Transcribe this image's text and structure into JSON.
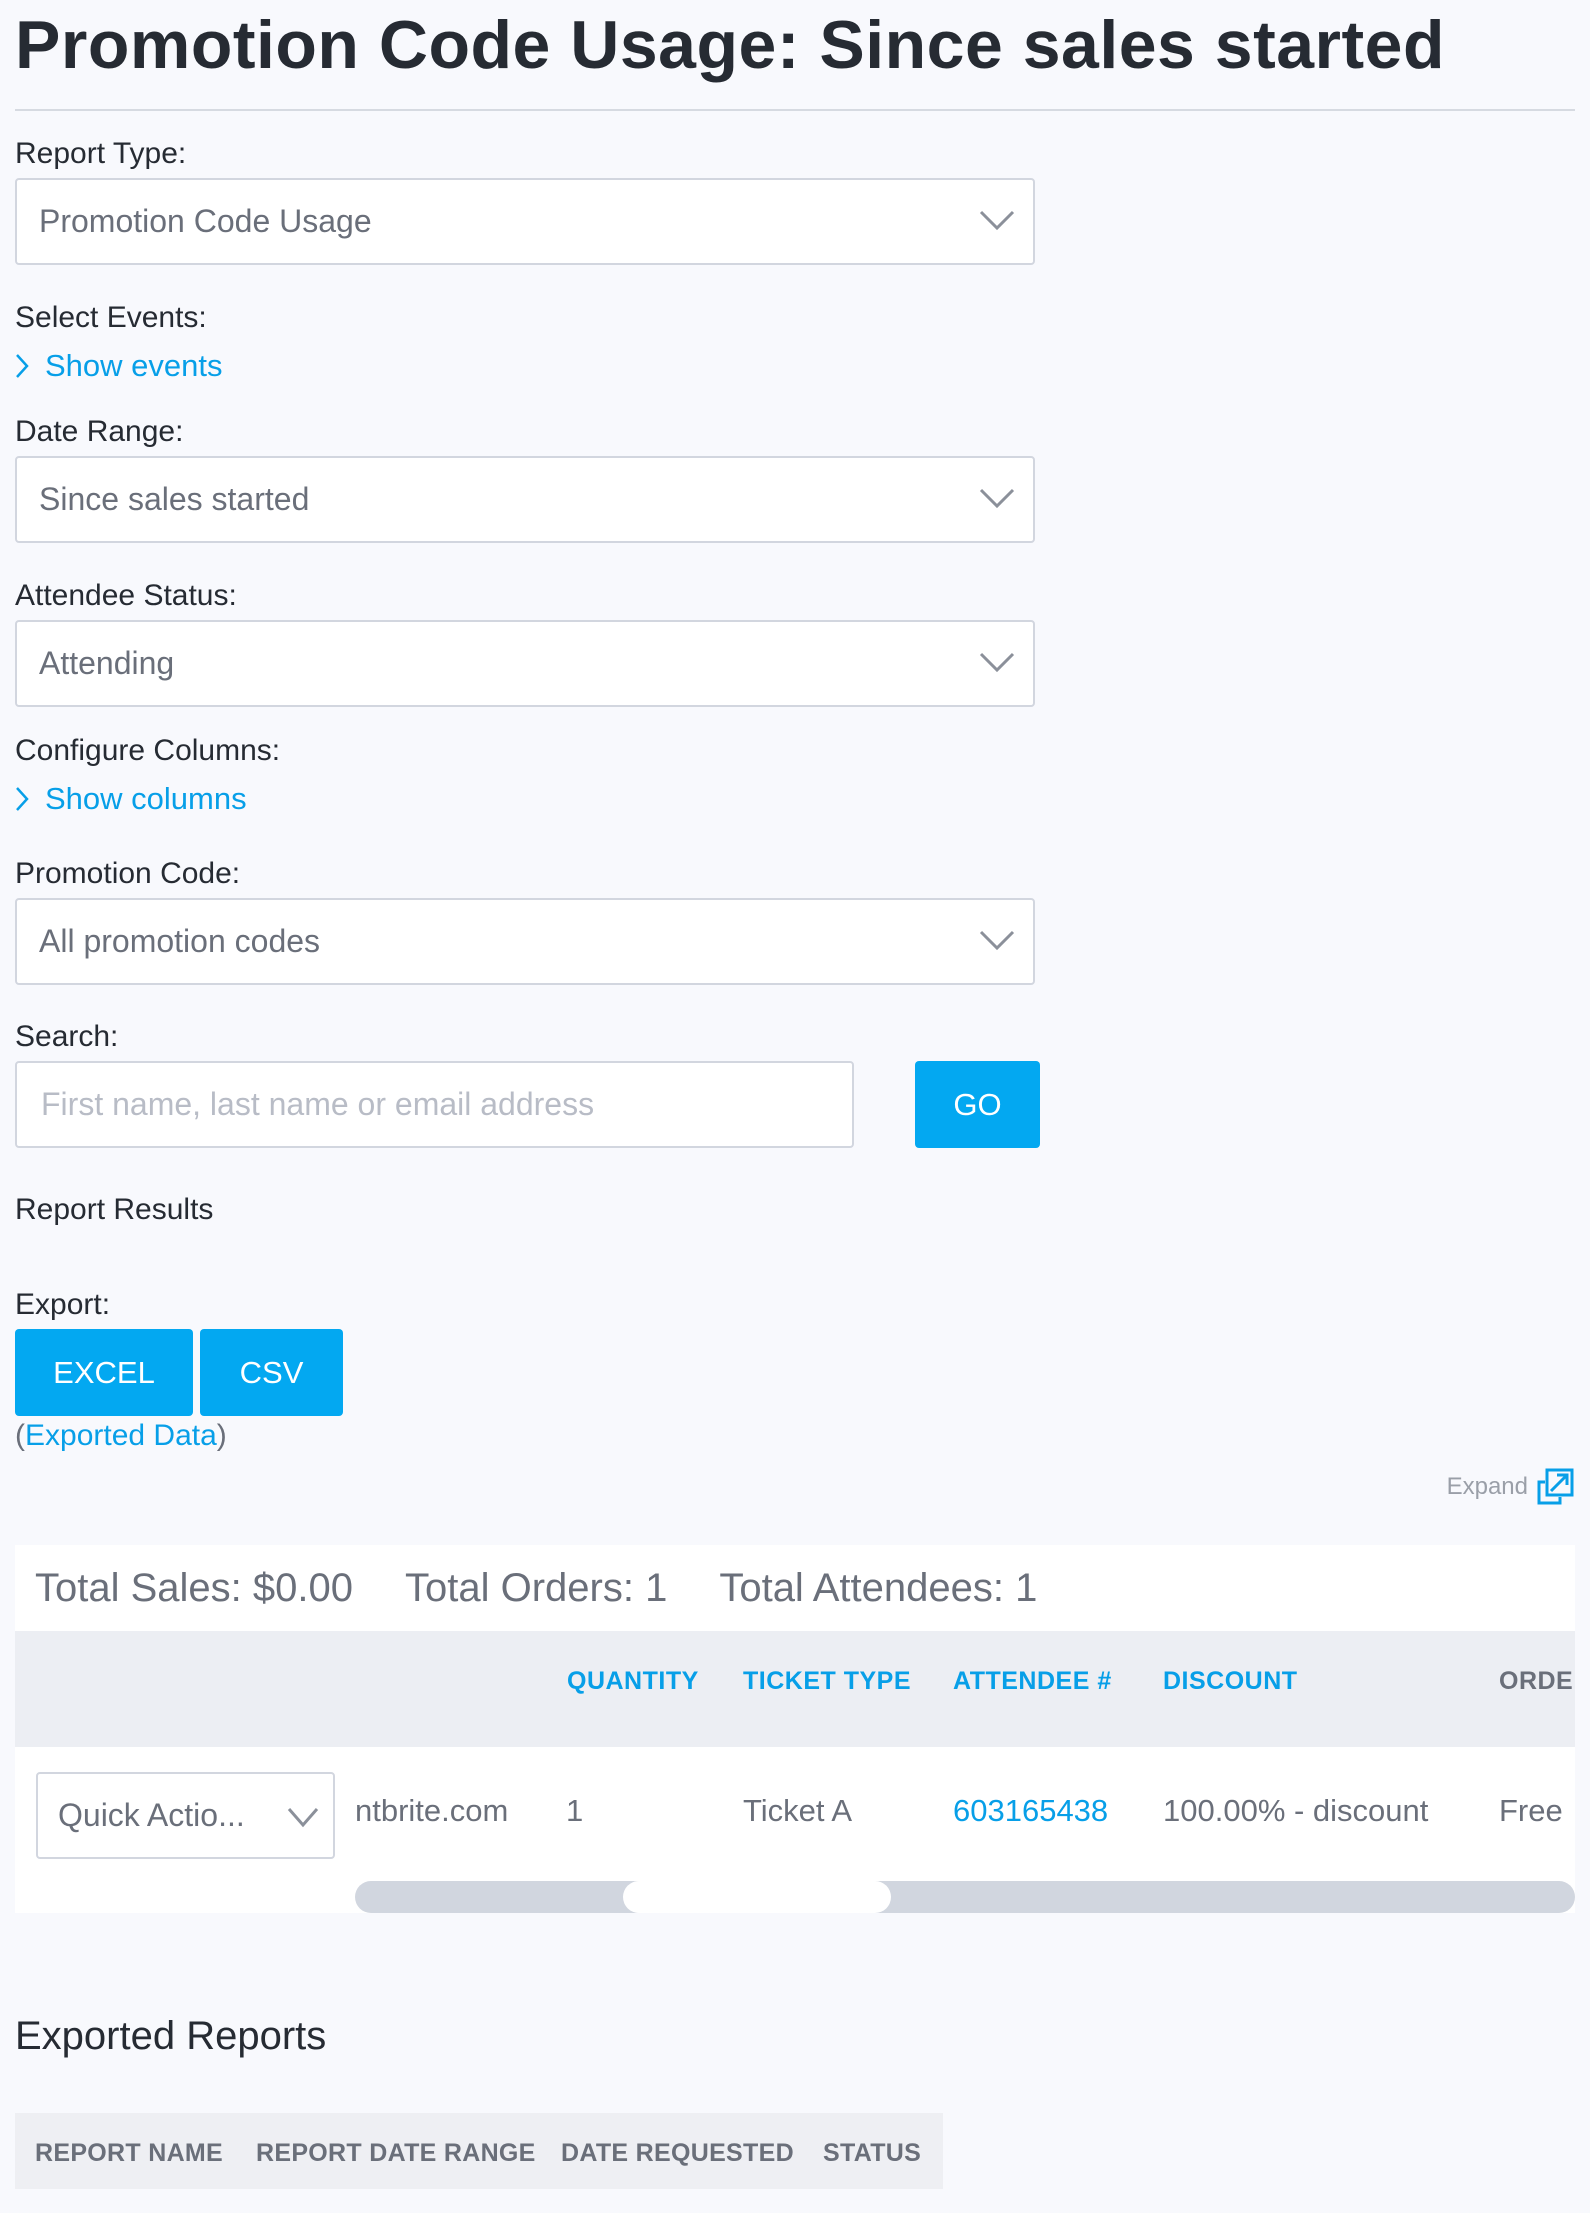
{
  "page": {
    "title": "Promotion Code Usage: Since sales started"
  },
  "form": {
    "report_type": {
      "label": "Report Type:",
      "value": "Promotion Code Usage"
    },
    "select_events": {
      "label": "Select Events:",
      "toggle": "Show events"
    },
    "date_range": {
      "label": "Date Range:",
      "value": "Since sales started"
    },
    "attendee_status": {
      "label": "Attendee Status:",
      "value": "Attending"
    },
    "configure_columns": {
      "label": "Configure Columns:",
      "toggle": "Show columns"
    },
    "promotion_code": {
      "label": "Promotion Code:",
      "value": "All promotion codes"
    },
    "search": {
      "label": "Search:",
      "placeholder": "First name, last name or email address",
      "value": "",
      "go_label": "GO"
    }
  },
  "results": {
    "heading": "Report Results",
    "export_label": "Export:",
    "export_buttons": [
      "EXCEL",
      "CSV"
    ],
    "exported_data_open": "(",
    "exported_data_link": "Exported Data",
    "exported_data_close": ")",
    "expand_label": "Expand",
    "totals": {
      "sales": "Total Sales: $0.00",
      "orders": "Total Orders: 1",
      "attendees": "Total Attendees: 1"
    },
    "columns": [
      {
        "label": "QUANTITY",
        "sortable": true
      },
      {
        "label": "TICKET TYPE",
        "sortable": true
      },
      {
        "label": "ATTENDEE #",
        "sortable": true
      },
      {
        "label": "DISCOUNT",
        "sortable": true
      },
      {
        "label": "ORDE",
        "sortable": false
      }
    ],
    "rows": [
      {
        "quick_action": "Quick Actio...",
        "email_fragment": "ntbrite.com",
        "quantity": "1",
        "ticket_type": "Ticket A",
        "attendee_number": "603165438",
        "discount": "100.00% - discount",
        "order_type": "Free"
      }
    ],
    "horizontal_scroll_position": 0.22
  },
  "exported_reports": {
    "heading": "Exported Reports",
    "columns": [
      "REPORT NAME",
      "REPORT DATE RANGE",
      "DATE REQUESTED",
      "STATUS"
    ]
  },
  "colors": {
    "accent": "#03a8f1",
    "link": "#079fe8",
    "text_dark": "#262b33",
    "text_muted": "#6a6f7a",
    "background": "#f8f9fd"
  }
}
